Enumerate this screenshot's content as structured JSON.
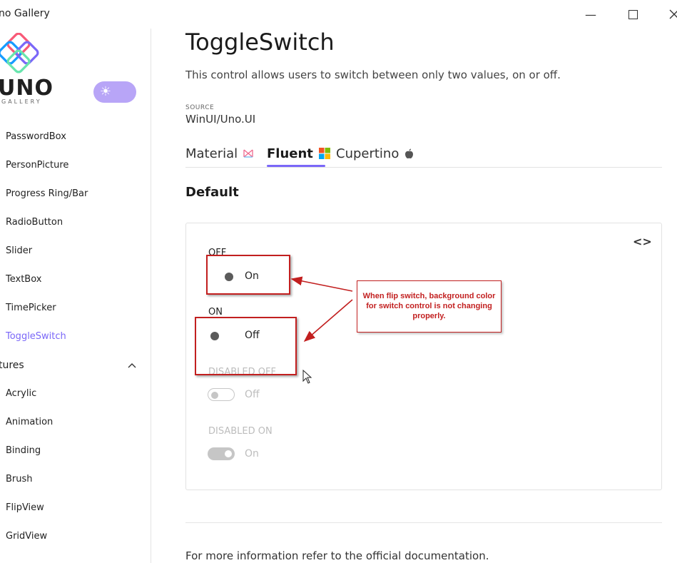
{
  "window": {
    "title": "no Gallery",
    "minimize": "—"
  },
  "sidebar": {
    "logo_text": "UNO",
    "logo_subtext": "GALLERY",
    "theme_icon": "sun-icon",
    "items": [
      {
        "label": "PasswordBox"
      },
      {
        "label": "PersonPicture"
      },
      {
        "label": "Progress Ring/Bar"
      },
      {
        "label": "RadioButton"
      },
      {
        "label": "Slider"
      },
      {
        "label": "TextBox"
      },
      {
        "label": "TimePicker"
      },
      {
        "label": "ToggleSwitch"
      }
    ],
    "group": {
      "label": "tures"
    },
    "group_items": [
      {
        "label": "Acrylic"
      },
      {
        "label": "Animation"
      },
      {
        "label": "Binding"
      },
      {
        "label": "Brush"
      },
      {
        "label": "FlipView"
      },
      {
        "label": "GridView"
      }
    ],
    "active_color": "#7a67f8"
  },
  "main": {
    "title": "ToggleSwitch",
    "description": "This control allows users to switch between only two values, on or off.",
    "source_label": "SOURCE",
    "source_value": "WinUI/Uno.UI",
    "tabs": [
      {
        "label": "Material",
        "icon": "material-icon"
      },
      {
        "label": "Fluent",
        "icon": "windows-icon"
      },
      {
        "label": "Cupertino",
        "icon": "apple-icon"
      }
    ],
    "active_tab": "Fluent",
    "section_title": "Default",
    "code_toggle": "<>",
    "samples": {
      "off_header": "OFF",
      "off_text": "On",
      "on_header": "ON",
      "on_text": "Off",
      "disabled_off_header": "DISABLED OFF",
      "disabled_off_text": "Off",
      "disabled_on_header": "DISABLED ON",
      "disabled_on_text": "On"
    },
    "footer_text": "For more information refer to the ",
    "footer_link": "official documentation."
  },
  "annotation": {
    "callout_text": "When flip switch, background color for switch control is not changing properly.",
    "color": "#c21f1f"
  }
}
